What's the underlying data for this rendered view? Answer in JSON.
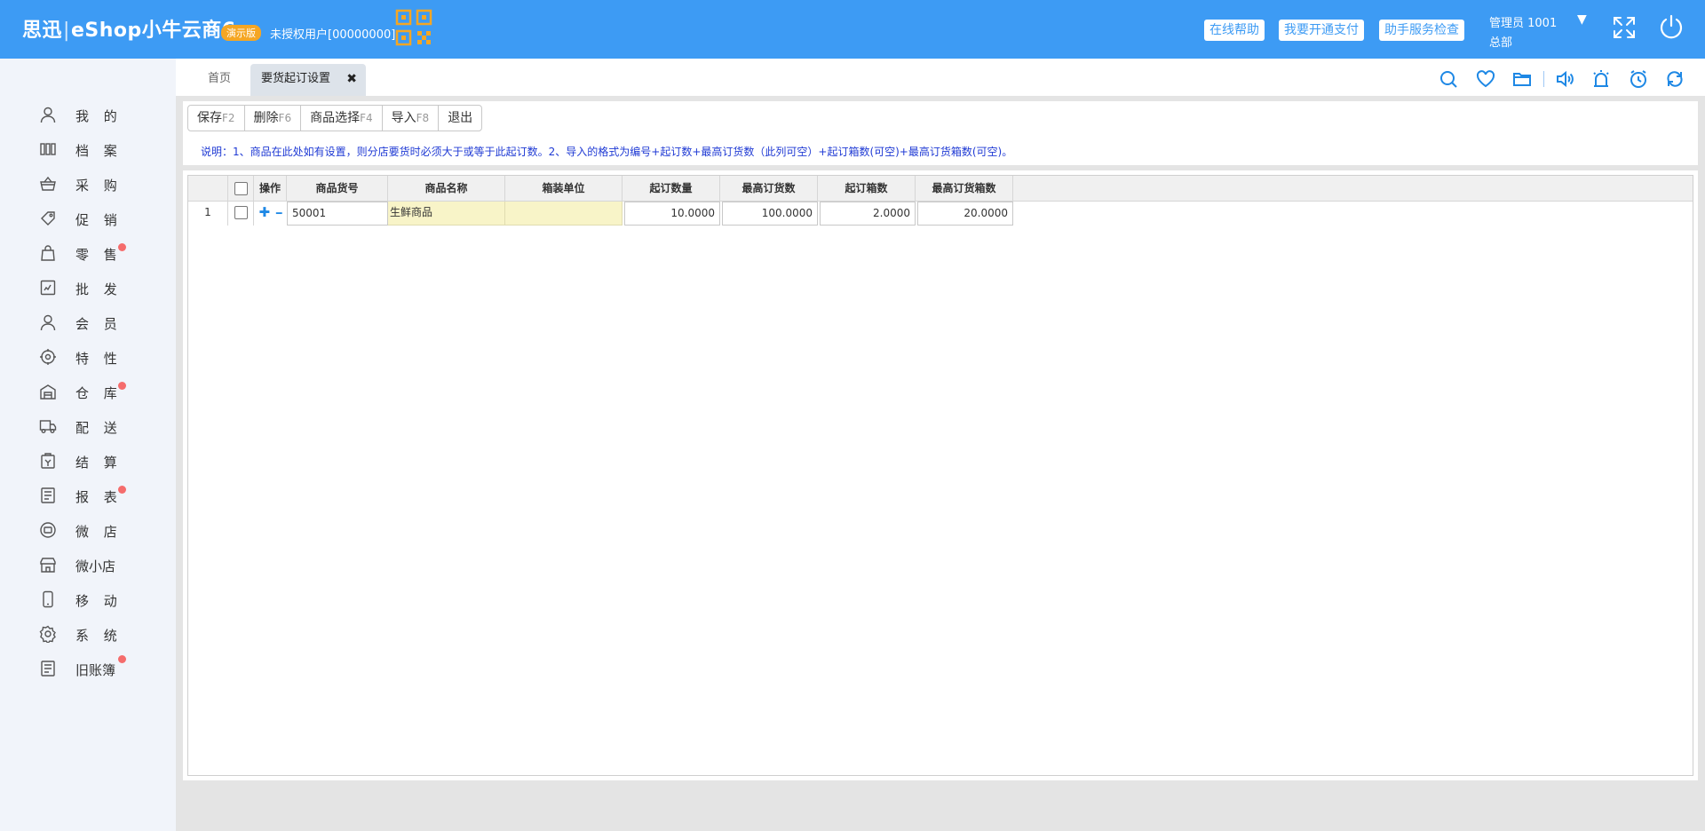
{
  "header": {
    "logo_cn": "思迅",
    "logo_sep": "|",
    "logo_app": "eShop小牛云商6",
    "demo_badge": "演示版",
    "user_info": "未授权用户[00000000]",
    "qr_icon": "qr-code-icon",
    "buttons": [
      "在线帮助",
      "我要开通支付",
      "助手服务检查"
    ],
    "admin_name": "管理员 1001",
    "admin_dropdown": "▼",
    "admin_branch": "总部",
    "colors": {
      "bar": "#3d9bf4",
      "badge": "#f5a623"
    }
  },
  "sidebar": {
    "items": [
      {
        "label": "我 的",
        "icon": "user-icon",
        "badge": false
      },
      {
        "label": "档 案",
        "icon": "archive-icon",
        "badge": false
      },
      {
        "label": "采 购",
        "icon": "basket-icon",
        "badge": false
      },
      {
        "label": "促 销",
        "icon": "tag-icon",
        "badge": false
      },
      {
        "label": "零 售",
        "icon": "shopping-bag-icon",
        "badge": true
      },
      {
        "label": "批 发",
        "icon": "wholesale-icon",
        "badge": false
      },
      {
        "label": "会 员",
        "icon": "member-icon",
        "badge": false
      },
      {
        "label": "特 性",
        "icon": "feature-icon",
        "badge": false
      },
      {
        "label": "仓 库",
        "icon": "warehouse-icon",
        "badge": true
      },
      {
        "label": "配 送",
        "icon": "truck-icon",
        "badge": false
      },
      {
        "label": "结 算",
        "icon": "settlement-icon",
        "badge": false
      },
      {
        "label": "报 表",
        "icon": "report-icon",
        "badge": true
      },
      {
        "label": "微 店",
        "icon": "micro-shop-icon",
        "badge": false
      },
      {
        "label": "微小店",
        "icon": "store-icon",
        "badge": false
      },
      {
        "label": "移 动",
        "icon": "mobile-icon",
        "badge": false
      },
      {
        "label": "系 统",
        "icon": "gear-icon",
        "badge": false
      },
      {
        "label": "旧账簿",
        "icon": "ledger-icon",
        "badge": true
      }
    ]
  },
  "tabs": {
    "home": "首页",
    "active": "要货起订设置",
    "close": "✖"
  },
  "toolbar_icons": [
    "search-icon",
    "heart-icon",
    "folder-icon",
    "speaker-icon",
    "alarm-light-icon",
    "clock-icon",
    "refresh-icon"
  ],
  "actions": [
    {
      "label": "保存",
      "key": "F2"
    },
    {
      "label": "删除",
      "key": "F6"
    },
    {
      "label": "商品选择",
      "key": "F4"
    },
    {
      "label": "导入",
      "key": "F8"
    },
    {
      "label": "退出",
      "key": ""
    }
  ],
  "note": "说明：1、商品在此处如有设置，则分店要货时必须大于或等于此起订数。2、导入的格式为编号+起订数+最高订货数（此列可空）+起订箱数(可空)+最高订货箱数(可空)。",
  "grid": {
    "columns": [
      "",
      "",
      "操作",
      "商品货号",
      "商品名称",
      "箱装单位",
      "起订数量",
      "最高订货数",
      "起订箱数",
      "最高订货箱数"
    ],
    "rows": [
      {
        "no": "1",
        "code": "50001",
        "name": "生鲜商品",
        "unit": "",
        "min_qty": "10.0000",
        "max_qty": "100.0000",
        "min_box": "2.0000",
        "max_box": "20.0000",
        "add": "✚",
        "remove": "━"
      }
    ]
  }
}
